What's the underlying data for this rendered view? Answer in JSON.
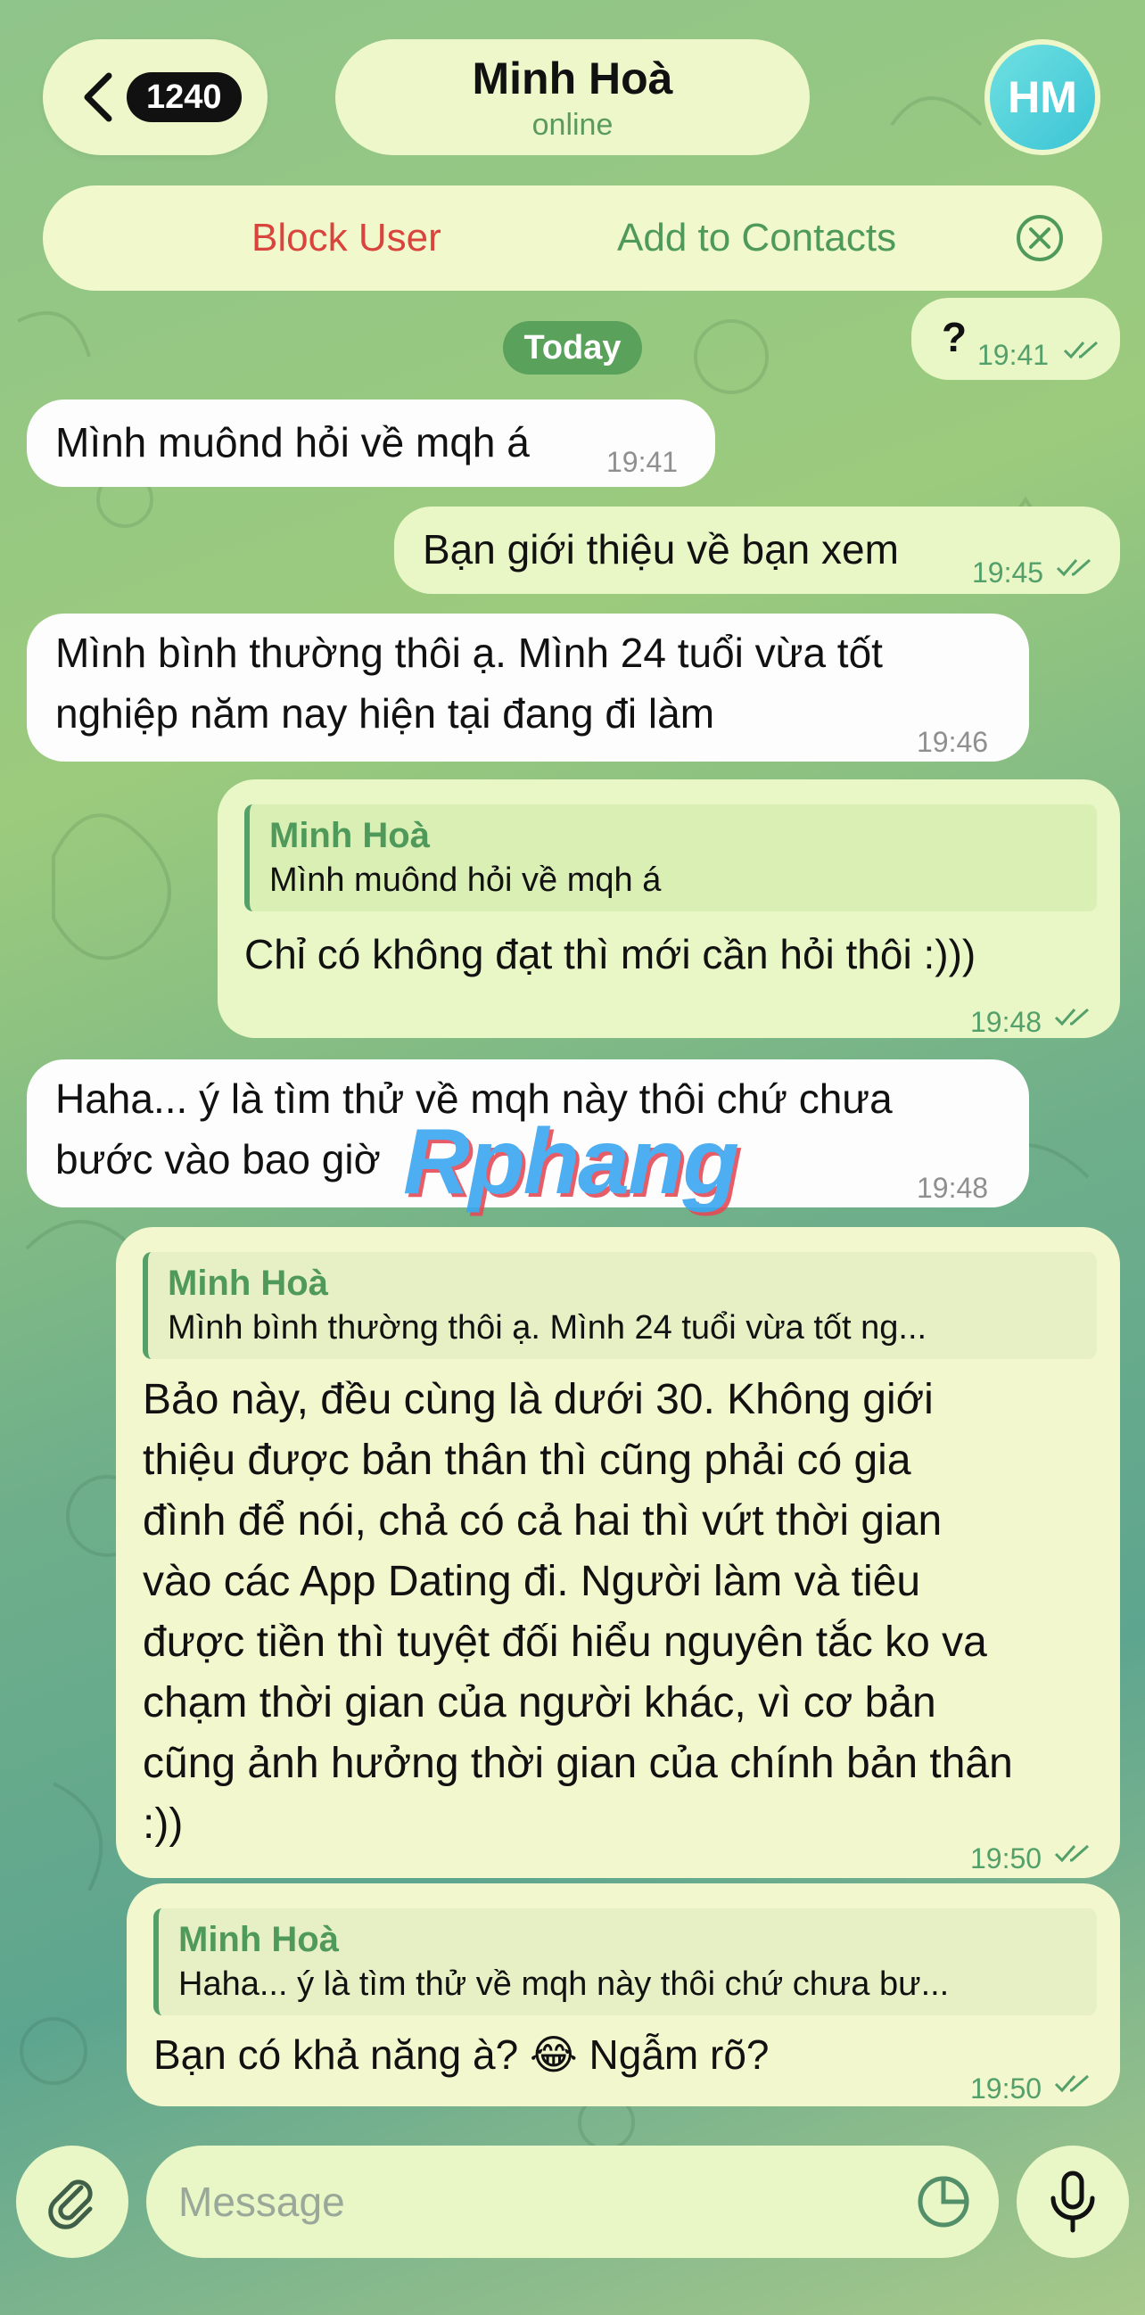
{
  "header": {
    "back_count": "1240",
    "contact_name": "Minh Hoà",
    "contact_status": "online",
    "avatar_initials": "HM"
  },
  "action_bar": {
    "block_label": "Block User",
    "add_label": "Add to Contacts"
  },
  "date_label": "Today",
  "messages": [
    {
      "dir": "out",
      "text": "?",
      "time": "19:41"
    },
    {
      "dir": "in",
      "text": "Mình muônd hỏi về mqh á",
      "time": "19:41"
    },
    {
      "dir": "out",
      "text": "Bạn giới thiệu về bạn xem",
      "time": "19:45"
    },
    {
      "dir": "in",
      "line1": "Mình bình thường thôi ạ. Mình 24 tuổi vừa tốt",
      "line2": "nghiệp năm nay hiện tại đang đi làm",
      "time": "19:46"
    },
    {
      "dir": "out",
      "reply_name": "Minh Hoà",
      "reply_text": "Mình muônd hỏi về mqh á",
      "text": "Chỉ có không đạt thì mới cần hỏi thôi :)))",
      "time": "19:48"
    },
    {
      "dir": "in",
      "line1": "Haha... ý là tìm thử về mqh này thôi chứ chưa",
      "line2": "bước vào bao giờ",
      "time": "19:48"
    },
    {
      "dir": "out",
      "reply_name": "Minh Hoà",
      "reply_text": "Mình bình thường thôi ạ. Mình 24 tuổi vừa tốt ng...",
      "lines": [
        "Bảo này, đều cùng là dưới 30. Không giới",
        "thiệu được bản thân thì cũng phải có gia",
        "đình để nói, chả có cả hai thì vứt thời gian",
        "vào các App Dating đi. Người làm và tiêu",
        "được tiền thì tuyệt đối hiểu nguyên tắc ko va",
        "chạm thời gian của người khác, vì cơ bản",
        "cũng ảnh hưởng thời gian của chính bản thân",
        ":))"
      ],
      "time": "19:50"
    },
    {
      "dir": "out",
      "reply_name": "Minh Hoà",
      "reply_text": "Haha... ý là tìm thử về mqh này thôi chứ chưa bư...",
      "text": "Bạn có khả năng à? 😂 Ngẫm rõ?",
      "time": "19:50"
    }
  ],
  "watermark": "Rphang",
  "composer": {
    "placeholder": "Message"
  },
  "icons": [
    "chevron-left-icon",
    "close-circle-icon",
    "read-ticks-icon",
    "paperclip-icon",
    "sticker-icon",
    "microphone-icon"
  ]
}
